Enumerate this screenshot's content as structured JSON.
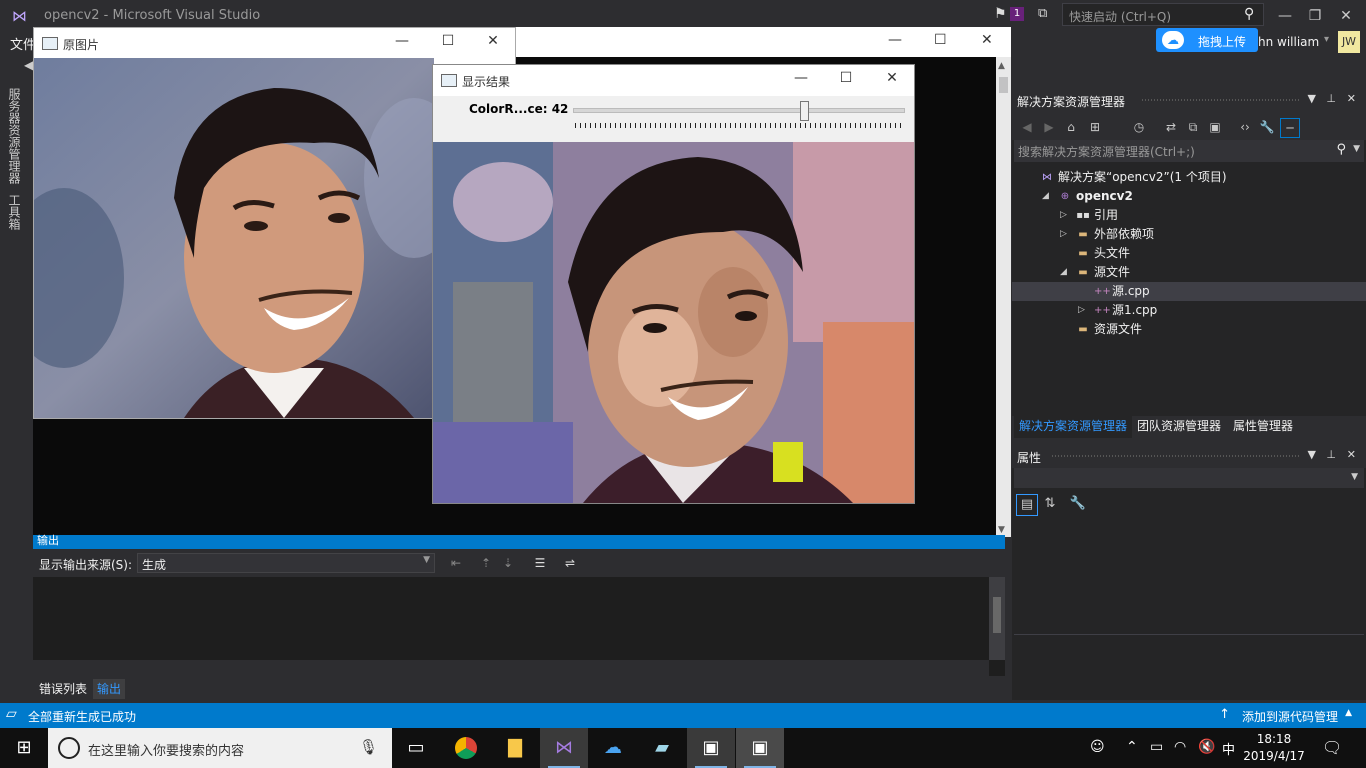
{
  "vs": {
    "title": "opencv2 - Microsoft Visual Studio",
    "quick_launch_placeholder": "快速启动 (Ctrl+Q)",
    "notification_count": "1",
    "menu_file": "文件",
    "upload_button": "拖拽上传",
    "user_name": "hn william",
    "user_initials": "JW",
    "left_tabs": [
      "服务器资源管理器",
      "工具箱"
    ]
  },
  "orig_window": {
    "title": "原图片"
  },
  "result_window": {
    "title": "显示结果",
    "trackbar_label": "ColorR...ce: 42",
    "trackbar_value": 42,
    "trackbar_max": 60
  },
  "output": {
    "panel_title": "输出",
    "source_label": "显示输出来源(S):",
    "source_value": "生成",
    "tabs": [
      "错误列表",
      "输出"
    ]
  },
  "solution_explorer": {
    "title": "解决方案资源管理器",
    "search_placeholder": "搜索解决方案资源管理器(Ctrl+;)",
    "tree": [
      {
        "label": "解决方案“opencv2”(1 个项目)",
        "indent": 0,
        "arrow": "",
        "icon": "solution",
        "bold": false,
        "selected": false
      },
      {
        "label": "opencv2",
        "indent": 1,
        "arrow": "◢",
        "icon": "project",
        "bold": true,
        "selected": false
      },
      {
        "label": "引用",
        "indent": 2,
        "arrow": "▷",
        "icon": "references",
        "bold": false,
        "selected": false
      },
      {
        "label": "外部依赖项",
        "indent": 2,
        "arrow": "▷",
        "icon": "folder",
        "bold": false,
        "selected": false
      },
      {
        "label": "头文件",
        "indent": 2,
        "arrow": "",
        "icon": "folder",
        "bold": false,
        "selected": false
      },
      {
        "label": "源文件",
        "indent": 2,
        "arrow": "◢",
        "icon": "folder",
        "bold": false,
        "selected": false
      },
      {
        "label": "源.cpp",
        "indent": 3,
        "arrow": "",
        "icon": "cpp",
        "bold": false,
        "selected": true
      },
      {
        "label": "源1.cpp",
        "indent": 3,
        "arrow": "▷",
        "icon": "cpp",
        "bold": false,
        "selected": false
      },
      {
        "label": "资源文件",
        "indent": 2,
        "arrow": "",
        "icon": "folder",
        "bold": false,
        "selected": false
      }
    ],
    "tabs": [
      "解决方案资源管理器",
      "团队资源管理器",
      "属性管理器"
    ]
  },
  "properties": {
    "title": "属性"
  },
  "status": {
    "message": "全部重新生成已成功",
    "source_control": "添加到源代码管理"
  },
  "taskbar": {
    "search_placeholder": "在这里输入你要搜索的内容",
    "time": "18:18",
    "date": "2019/4/17",
    "ime": "中"
  }
}
